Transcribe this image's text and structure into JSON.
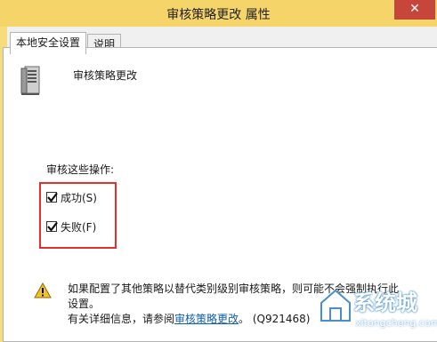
{
  "window": {
    "title": "审核策略更改 属性",
    "close_glyph": "✕"
  },
  "tabs": [
    {
      "label": "本地安全设置",
      "active": true
    },
    {
      "label": "说明",
      "active": false
    }
  ],
  "policy": {
    "name": "审核策略更改"
  },
  "audit": {
    "heading": "审核这些操作:",
    "options": [
      {
        "label": "成功(S)",
        "checked": true
      },
      {
        "label": "失败(F)",
        "checked": true
      }
    ]
  },
  "warning": {
    "line1": "如果配置了其他策略以替代类别级别审核策略，则可能不会强制执行此",
    "line2": "设置。",
    "line3_prefix": "有关详细信息，请参阅",
    "link_text": "审核策略更改",
    "line3_suffix": "。 (Q921468)"
  },
  "watermark": {
    "brand": "系统城",
    "url": "xitongcheng.com"
  },
  "colors": {
    "titlebar": "#f5d56a",
    "close": "#c7463b",
    "highlight_box": "#e0312f",
    "link": "#0f5fb3"
  }
}
